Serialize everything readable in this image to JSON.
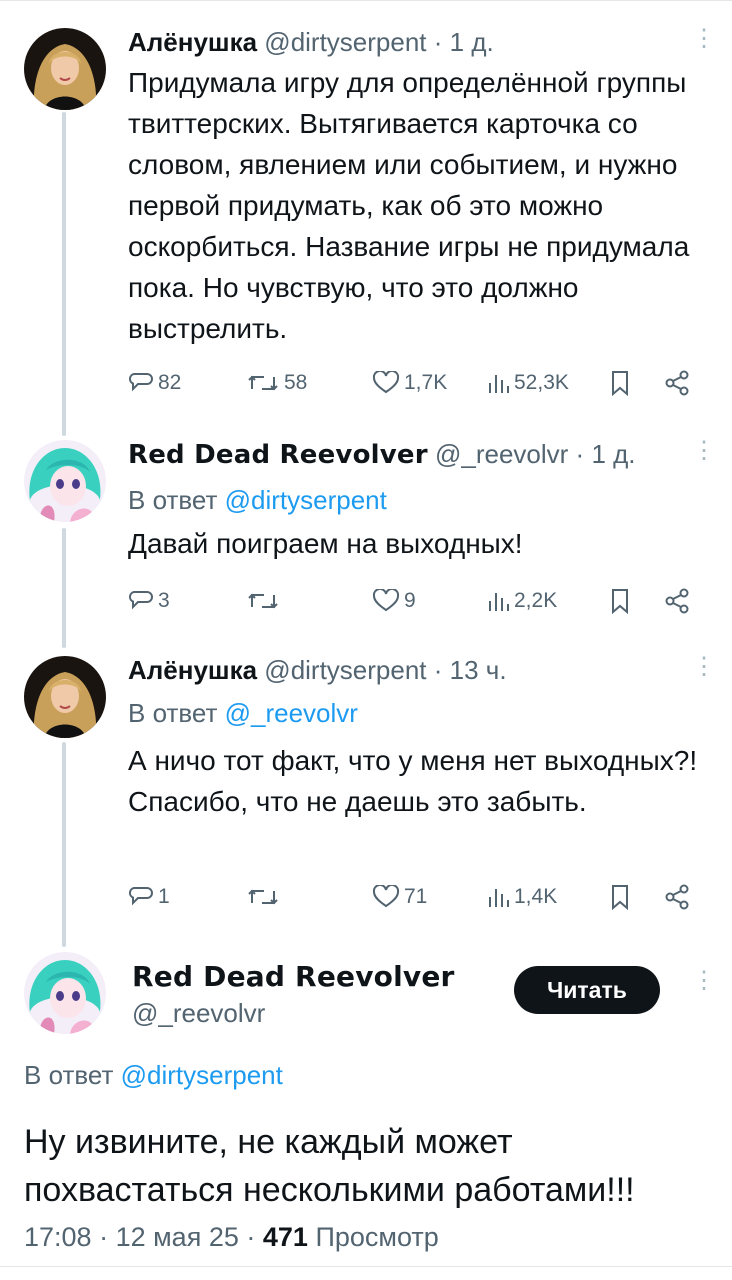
{
  "tweets": [
    {
      "name": "Алёнушка",
      "handle": "@dirtyserpent",
      "time": "1 д.",
      "text": "Придумала игру для определённой группы твиттерских. Вытягивается карточка со словом, явлением или событием, и нужно первой придумать, как об это можно оскорбиться. Название игры не придумала пока. Но чувствую, что это должно выстрелить.",
      "replies": "82",
      "retweets": "58",
      "likes": "1,7K",
      "views": "52,3K"
    },
    {
      "name": "Red Dead Reevolver",
      "handle": "@_reevolvr",
      "time": "1 д.",
      "reply_prefix": "В ответ",
      "reply_to": "@dirtyserpent",
      "text": "Давай поиграем на выходных!",
      "replies": "3",
      "retweets": "",
      "likes": "9",
      "views": "2,2K"
    },
    {
      "name": "Алёнушка",
      "handle": "@dirtyserpent",
      "time": "13 ч.",
      "reply_prefix": "В ответ",
      "reply_to": "@_reevolvr",
      "text": "А ничо тот факт, что у меня нет выходных?! Спасибо, что не даешь это забыть.",
      "replies": "1",
      "retweets": "",
      "likes": "71",
      "views": "1,4K"
    }
  ],
  "main": {
    "name": "Red Dead Reevolver",
    "handle": "@_reevolvr",
    "follow_label": "Читать",
    "reply_prefix": "В ответ",
    "reply_to": "@dirtyserpent",
    "text": "Ну извините, не каждый может похвастаться несколькими работами!!!",
    "time": "17:08",
    "date": "12 мая 25",
    "views_count": "471",
    "views_label": "Просмотр"
  },
  "colors": {
    "text": "#0f1419",
    "secondary": "#536471",
    "link": "#1d9bf0",
    "thread_line": "#cfd9de"
  }
}
